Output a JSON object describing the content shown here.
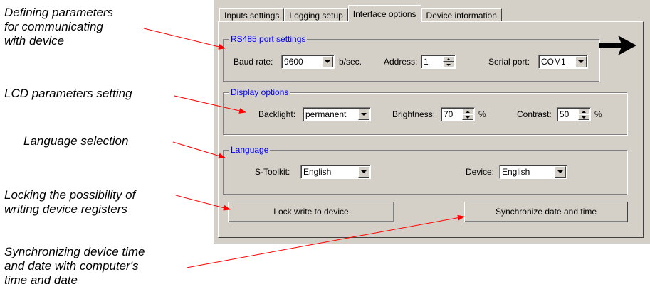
{
  "callouts": {
    "communication": "Defining parameters\nfor communicating\nwith device",
    "lcd": "LCD parameters setting",
    "language": "Language selection",
    "locking": "Locking the possibility of\nwriting device registers",
    "sync": "Synchronizing device time\nand date with computer's\ntime and date"
  },
  "tabs": [
    "Inputs settings",
    "Logging setup",
    "Interface options",
    "Device information"
  ],
  "active_tab": "Interface options",
  "rs485": {
    "title": "RS485 port settings",
    "baud_label": "Baud rate:",
    "baud_value": "9600",
    "baud_unit": "b/sec.",
    "address_label": "Address:",
    "address_value": "1",
    "serial_label": "Serial port:",
    "serial_value": "COM1"
  },
  "display": {
    "title": "Display options",
    "backlight_label": "Backlight:",
    "backlight_value": "permanent",
    "brightness_label": "Brightness:",
    "brightness_value": "70",
    "brightness_unit": "%",
    "contrast_label": "Contrast:",
    "contrast_value": "50",
    "contrast_unit": "%"
  },
  "language": {
    "title": "Language",
    "stoolkit_label": "S-Toolkit:",
    "stoolkit_value": "English",
    "device_label": "Device:",
    "device_value": "English"
  },
  "buttons": {
    "lock": "Lock write to device",
    "sync": "Synchronize date and time"
  },
  "colors": {
    "arrow_red": "#ff0000",
    "group_title": "#0000ff",
    "window_bg": "#d4d0c8"
  },
  "icons": {
    "big_arrow": "right-arrow-icon",
    "dropdown": "chevron-down-icon",
    "spinner": "spinner-updown-icon"
  }
}
